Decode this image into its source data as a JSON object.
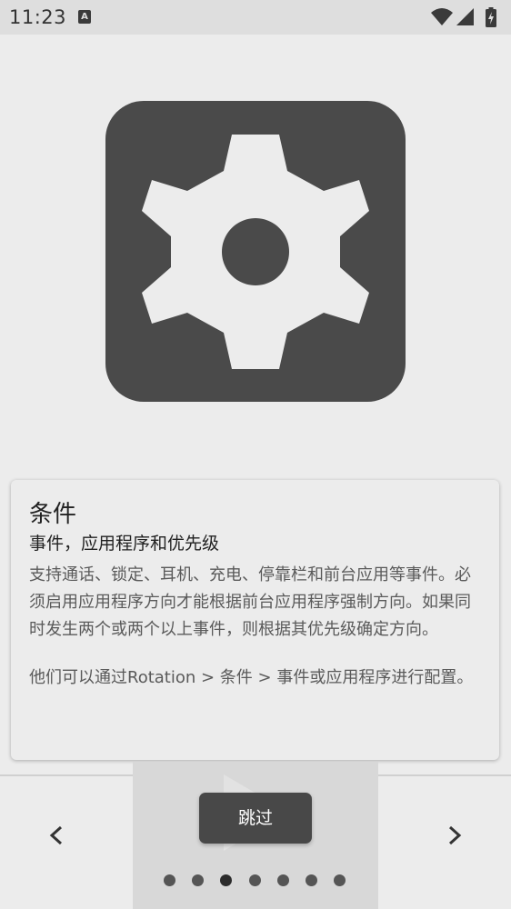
{
  "status_bar": {
    "time": "11:23",
    "notification_icon": "a-letter-icon",
    "notification_glyph": "A",
    "icons": [
      "wifi-icon",
      "signal-icon",
      "battery-charging-icon"
    ]
  },
  "hero": {
    "icon": "gear-icon",
    "tile_color": "#4a4a4a",
    "gear_color": "#ececec"
  },
  "card": {
    "title": "条件",
    "subtitle": "事件，应用程序和优先级",
    "body": "支持通话、锁定、耳机、充电、停靠栏和前台应用等事件。必须启用应用程序方向才能根据前台应用程序强制方向。如果同时发生两个或两个以上事件，则根据其优先级确定方向。",
    "body_2": "他们可以通过Rotation > 条件 > 事件或应用程序进行配置。"
  },
  "bottom_nav": {
    "skip_label": "跳过",
    "prev_icon": "chevron-left-icon",
    "next_icon": "chevron-right-icon",
    "page_count": 7,
    "current_page": 3
  }
}
